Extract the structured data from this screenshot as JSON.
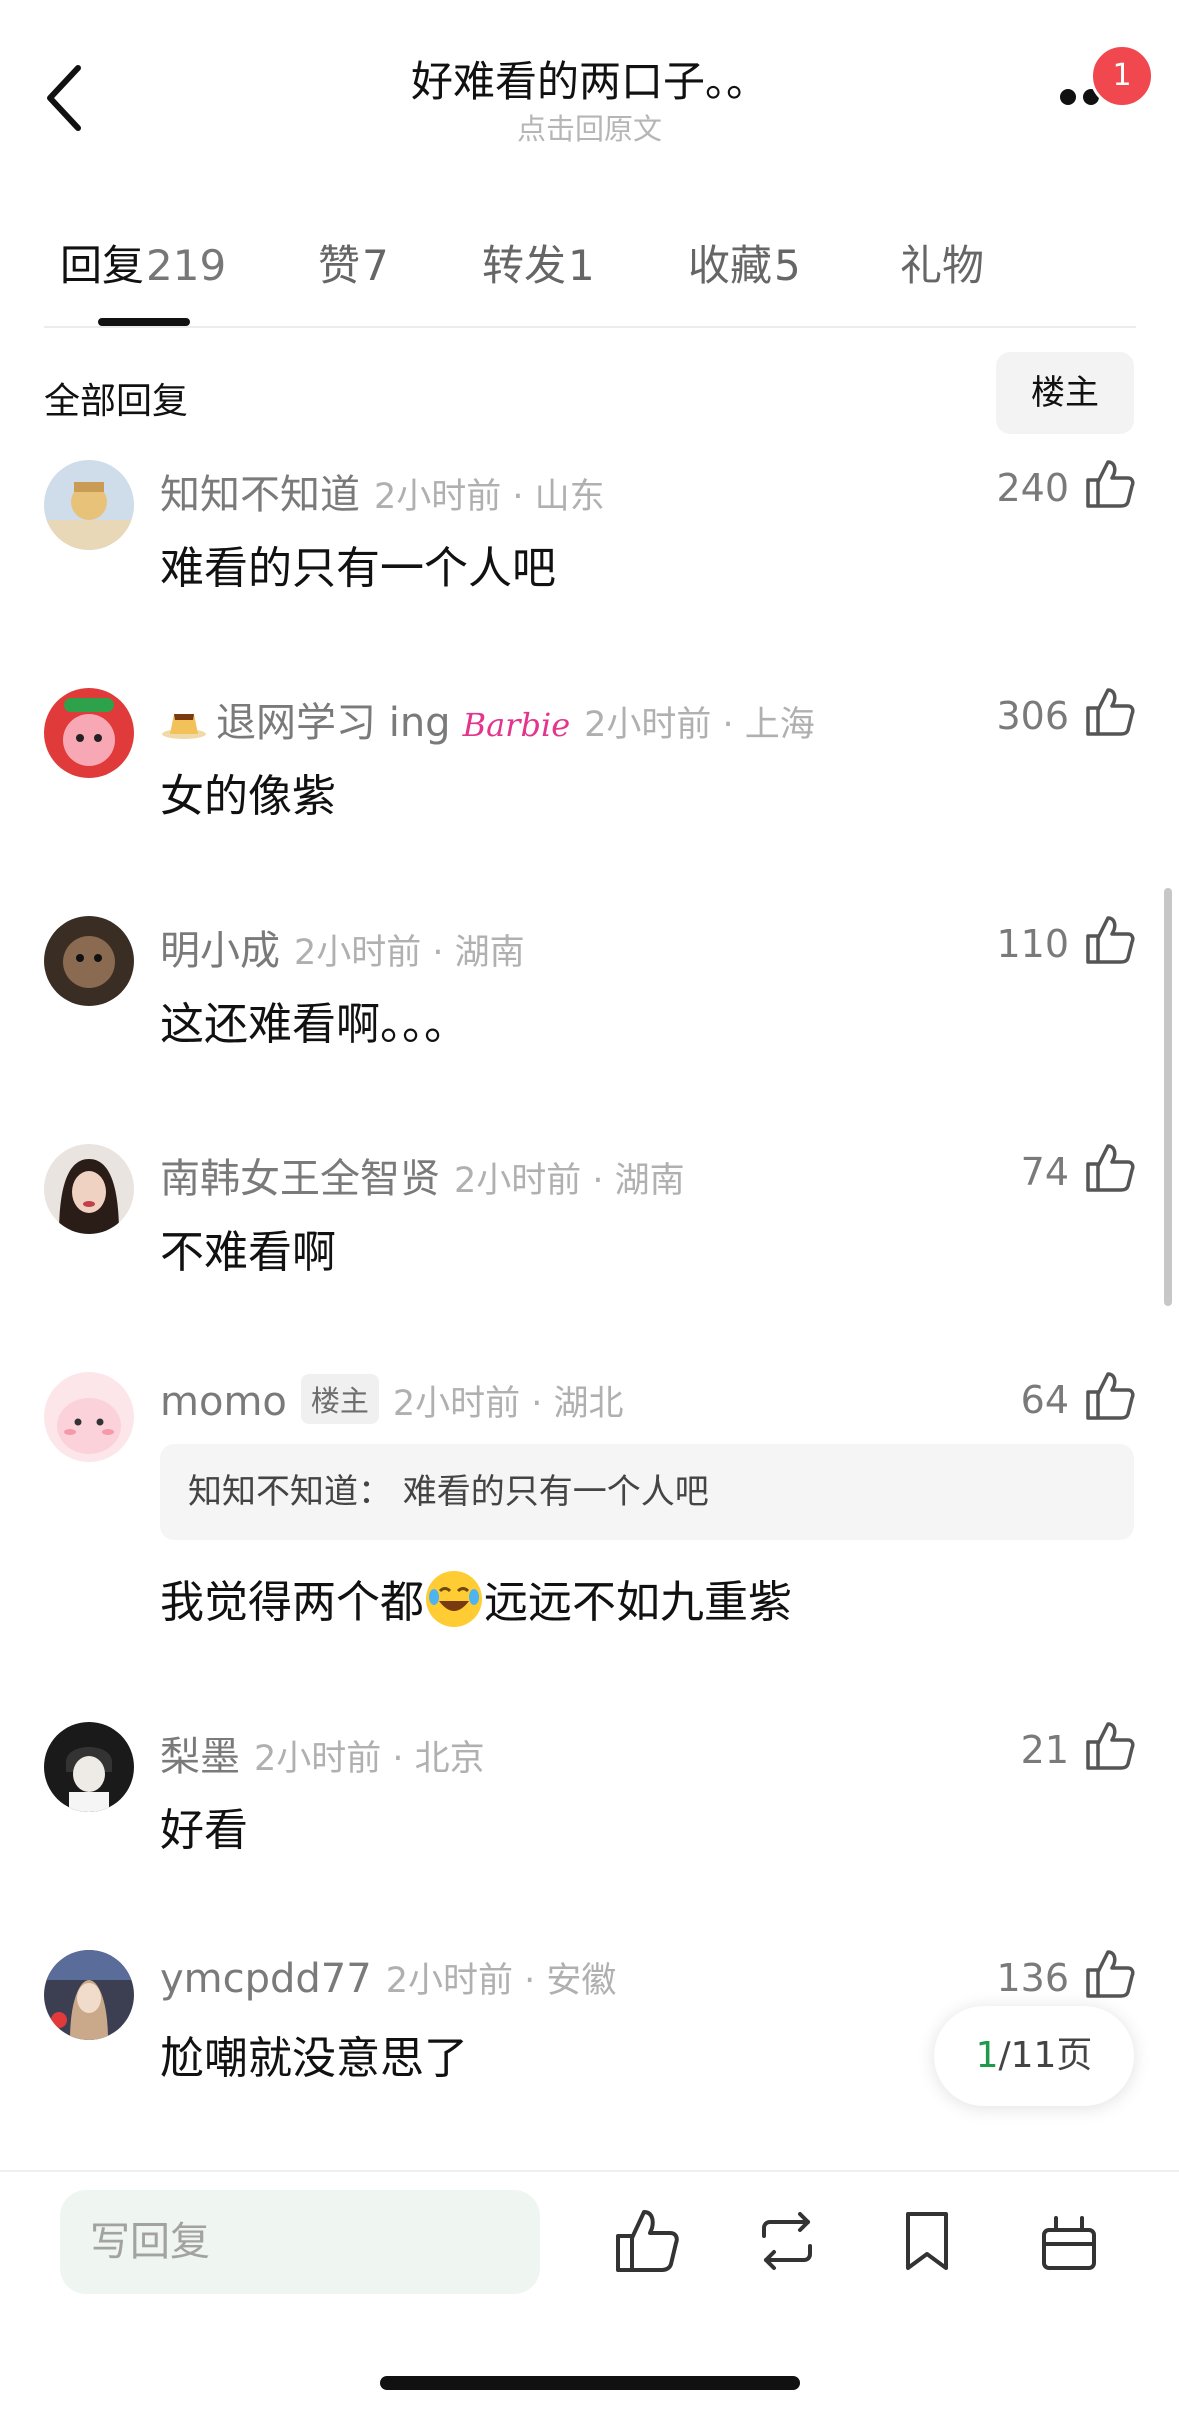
{
  "header": {
    "title": "好难看的两口子。。",
    "subtitle": "点击回原文",
    "notification_count": "1"
  },
  "tabs": [
    {
      "label": "回复",
      "count": "219"
    },
    {
      "label": "赞",
      "count": "7"
    },
    {
      "label": "转发",
      "count": "1"
    },
    {
      "label": "收藏",
      "count": "5"
    },
    {
      "label": "礼物",
      "count": ""
    }
  ],
  "section": {
    "title": "全部回复",
    "filter_label": "楼主"
  },
  "comments": [
    {
      "username": "知知不知道",
      "meta": "2小时前 · 山东",
      "likes": "240",
      "text": "难看的只有一个人吧"
    },
    {
      "username": "退网学习 ing",
      "username_badge": "Barbie",
      "meta": "2小时前 · 上海",
      "likes": "306",
      "text": "女的像紫"
    },
    {
      "username": "明小成",
      "meta": "2小时前 · 湖南",
      "likes": "110",
      "text": "这还难看啊。。。"
    },
    {
      "username": "南韩女王全智贤",
      "meta": "2小时前 · 湖南",
      "likes": "74",
      "text": "不难看啊"
    },
    {
      "username": "momo",
      "tag": "楼主",
      "meta": "2小时前 · 湖北",
      "likes": "64",
      "quote": "知知不知道：  难看的只有一个人吧",
      "text_before": "我觉得两个都",
      "text_after": "远远不如九重紫"
    },
    {
      "username": "梨墨",
      "meta": "2小时前 · 北京",
      "likes": "21",
      "text": "好看"
    },
    {
      "username": "ymcpdd77",
      "meta": "2小时前 · 安徽",
      "likes": "136",
      "text": "尬嘲就没意思了"
    }
  ],
  "pagination": {
    "current": "1",
    "rest": "/11页"
  },
  "bottom_bar": {
    "reply_placeholder": "写回复"
  }
}
